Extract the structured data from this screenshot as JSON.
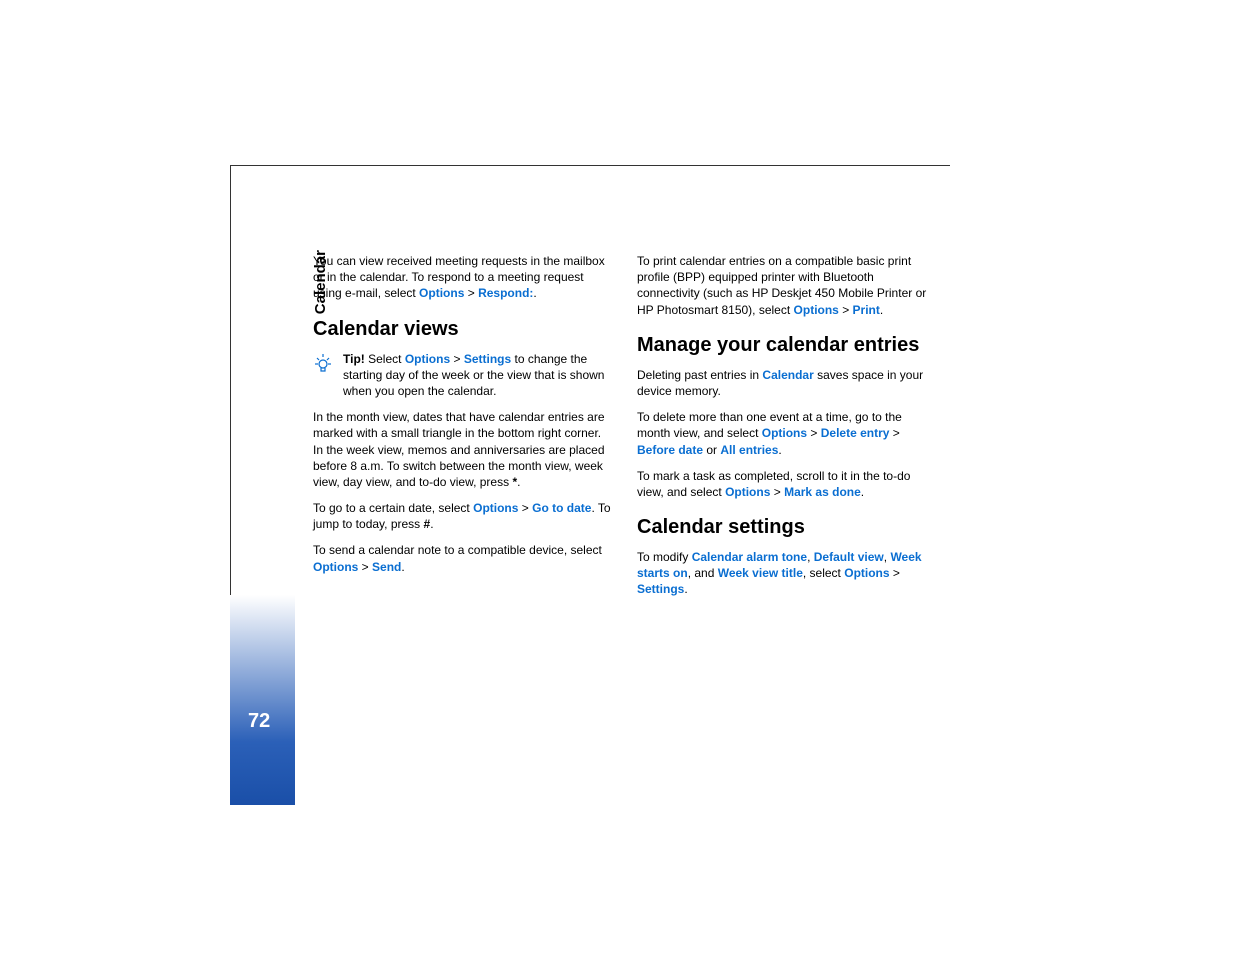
{
  "sidebar": {
    "section_label": "Calendar",
    "page_number": "72"
  },
  "left_column": {
    "intro": {
      "text_before": "You can view received meeting requests in the mailbox or in the calendar. To respond to a meeting request using e-mail, select ",
      "options": "Options",
      "sep": " > ",
      "respond": "Respond:",
      "period": "."
    },
    "heading1": "Calendar views",
    "tip": {
      "label": "Tip!",
      "pre": " Select ",
      "options": "Options",
      "sep": " > ",
      "settings": "Settings",
      "post": " to change the starting day of the week or the view that is shown when you open the calendar."
    },
    "month_view": "In the month view, dates that have calendar entries are marked with a small triangle in the bottom right corner. In the week view, memos and anniversaries are placed before 8 a.m. To switch between the month view, week view, day view, and to-do view, press ",
    "month_view_key": "*",
    "month_view_end": ".",
    "goto": {
      "pre": "To go to a certain date, select ",
      "options": "Options",
      "sep": " > ",
      "goto_date": "Go to date",
      "mid": ". To jump to today, press ",
      "key": "#",
      "end": "."
    },
    "send": {
      "pre": "To send a calendar note to a compatible device, select ",
      "options": "Options",
      "sep": " > ",
      "send": "Send",
      "end": "."
    }
  },
  "right_column": {
    "print": {
      "pre": "To print calendar entries on a compatible basic print profile (BPP) equipped printer with Bluetooth connectivity (such as HP Deskjet 450 Mobile Printer or HP Photosmart 8150), select ",
      "options": "Options",
      "sep": " > ",
      "print_cmd": "Print",
      "end": "."
    },
    "heading2": "Manage your calendar entries",
    "delete_intro": {
      "pre": "Deleting past entries in ",
      "calendar": "Calendar",
      "post": " saves space in your device memory."
    },
    "delete_many": {
      "pre": "To delete more than one event at a time, go to the month view, and select ",
      "options": "Options",
      "sep": " > ",
      "delete_entry": "Delete entry",
      "sep2": " > ",
      "before_date": "Before date",
      "or": " or ",
      "all_entries": "All entries",
      "end": "."
    },
    "mark_done": {
      "pre": "To mark a task as completed, scroll to it in the to-do view, and select ",
      "options": "Options",
      "sep": " > ",
      "mark": "Mark as done",
      "end": "."
    },
    "heading3": "Calendar settings",
    "settings_para": {
      "pre": "To modify ",
      "alarm": "Calendar alarm tone",
      "c1": ", ",
      "default_view": "Default view",
      "c2": ", ",
      "week_starts": "Week starts on",
      "and": ", and ",
      "week_title": "Week view title",
      "sel": ", select ",
      "options": "Options",
      "sep": " > ",
      "settings": "Settings",
      "end": "."
    }
  }
}
